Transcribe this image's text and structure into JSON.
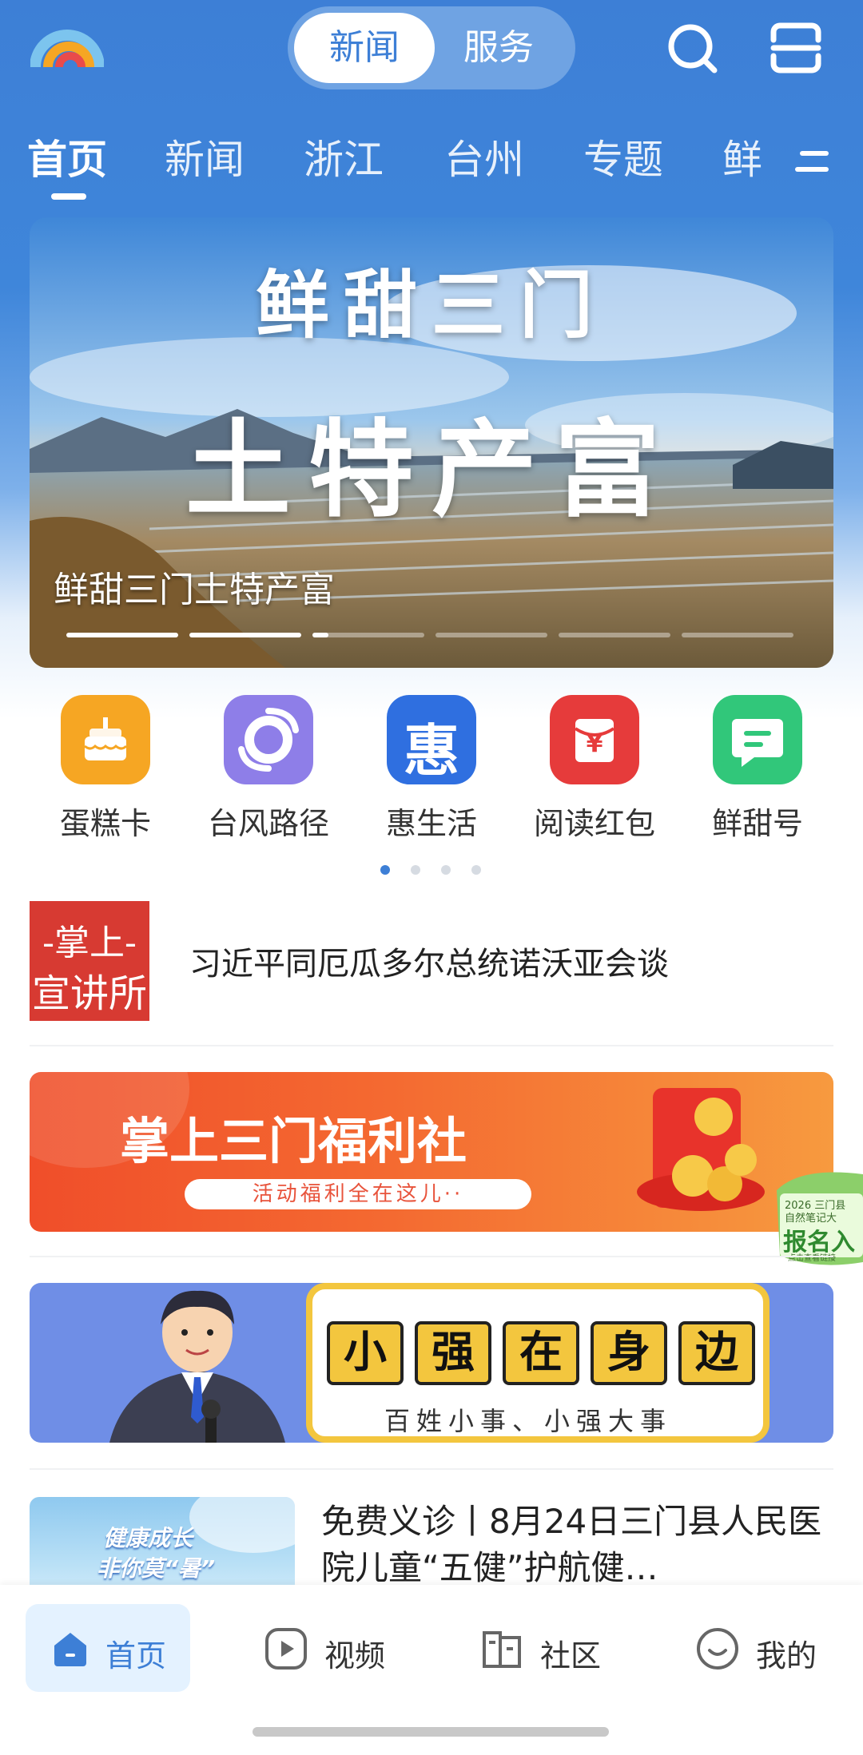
{
  "header": {
    "segments": [
      "新闻",
      "服务"
    ],
    "active_segment": "新闻"
  },
  "tabs": [
    "首页",
    "新闻",
    "浙江",
    "台州",
    "专题",
    "鲜"
  ],
  "banner": {
    "title_top": "鲜甜三门",
    "title_main": "土特产富",
    "caption": "鲜甜三门土特产富",
    "slides": 6,
    "active_slide": 3
  },
  "quick_links": [
    {
      "label": "蛋糕卡",
      "icon": "cake-icon",
      "color": "#f6a623"
    },
    {
      "label": "台风路径",
      "icon": "typhoon-icon",
      "color": "#8e7ee8"
    },
    {
      "label": "惠生活",
      "icon": "hui-icon",
      "color": "#2f6fe0",
      "glyph": "惠"
    },
    {
      "label": "阅读红包",
      "icon": "red-packet-icon",
      "color": "#e63b3b",
      "glyph": "¥"
    },
    {
      "label": "鲜甜号",
      "icon": "message-icon",
      "color": "#31c77a"
    }
  ],
  "quick_pager": {
    "pages": 4,
    "active": 1
  },
  "news": [
    {
      "title": "习近平同厄瓜多尔总统诺沃亚会谈",
      "thumb_line1": "-掌上-",
      "thumb_line2": "宣讲所"
    },
    {
      "title": "免费义诊丨8月24日三门县人民医院儿童“五健”护航健…",
      "thumb_line1": "健康成长",
      "thumb_line2": "非你莫“暑”"
    }
  ],
  "promo": {
    "title": "掌上三门福利社",
    "subtitle": "活动福利全在这儿··"
  },
  "float_badge": {
    "small": "2026 三门县",
    "small2": "自然笔记大",
    "big": "报名入",
    "foot": "点击查看链接"
  },
  "xiaoqiang": {
    "chars": [
      "小",
      "强",
      "在",
      "身",
      "边"
    ],
    "subtitle": "百姓小事、小强大事"
  },
  "bottom_nav": [
    {
      "label": "首页",
      "icon": "home-icon"
    },
    {
      "label": "视频",
      "icon": "play-icon"
    },
    {
      "label": "社区",
      "icon": "community-icon"
    },
    {
      "label": "我的",
      "icon": "smile-icon"
    }
  ],
  "colors": {
    "brand": "#3d7fd6",
    "active_nav_bg": "#e4f2ff"
  }
}
